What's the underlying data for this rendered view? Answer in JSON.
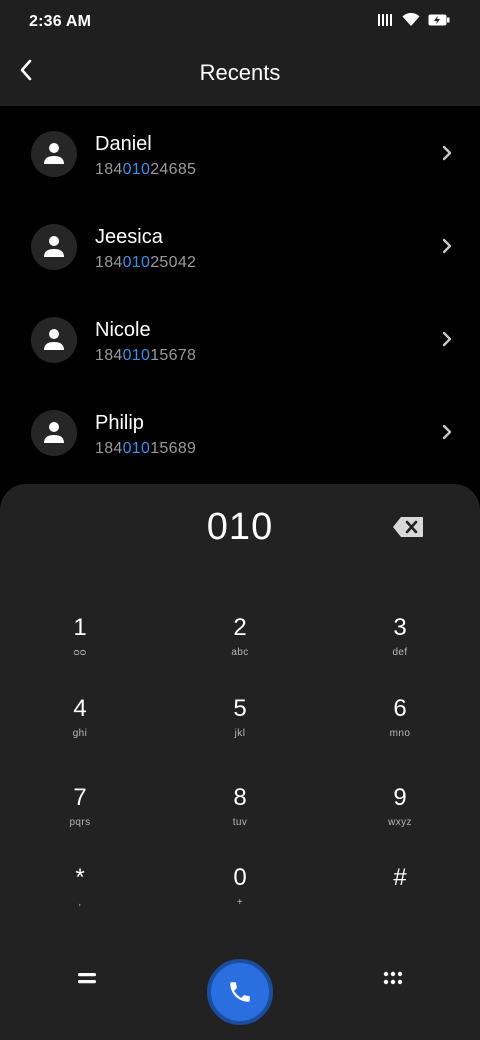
{
  "status_bar": {
    "time": "2:36 AM"
  },
  "header": {
    "title": "Recents"
  },
  "contacts": [
    {
      "name": "Daniel",
      "number_pre": "184",
      "number_match": "010",
      "number_post": "24685"
    },
    {
      "name": "Jeesica",
      "number_pre": "184",
      "number_match": "010",
      "number_post": "25042"
    },
    {
      "name": "Nicole",
      "number_pre": "184",
      "number_match": "010",
      "number_post": "15678"
    },
    {
      "name": "Philip",
      "number_pre": "184",
      "number_match": "010",
      "number_post": "15689"
    }
  ],
  "dialpad": {
    "display": "010",
    "keys": [
      {
        "digit": "1",
        "letters": "ᴑᴑ"
      },
      {
        "digit": "2",
        "letters": "abc"
      },
      {
        "digit": "3",
        "letters": "def"
      },
      {
        "digit": "4",
        "letters": "ghi"
      },
      {
        "digit": "5",
        "letters": "jkl"
      },
      {
        "digit": "6",
        "letters": "mno"
      },
      {
        "digit": "7",
        "letters": "pqrs"
      },
      {
        "digit": "8",
        "letters": "tuv"
      },
      {
        "digit": "9",
        "letters": "wxyz"
      },
      {
        "digit": "*",
        "letters": ","
      },
      {
        "digit": "0",
        "letters": "+"
      },
      {
        "digit": "#",
        "letters": ""
      }
    ]
  },
  "colors": {
    "accent": "#2a6fe0",
    "match_highlight": "#3a8fe8",
    "panel": "#222222",
    "background": "#000000"
  }
}
